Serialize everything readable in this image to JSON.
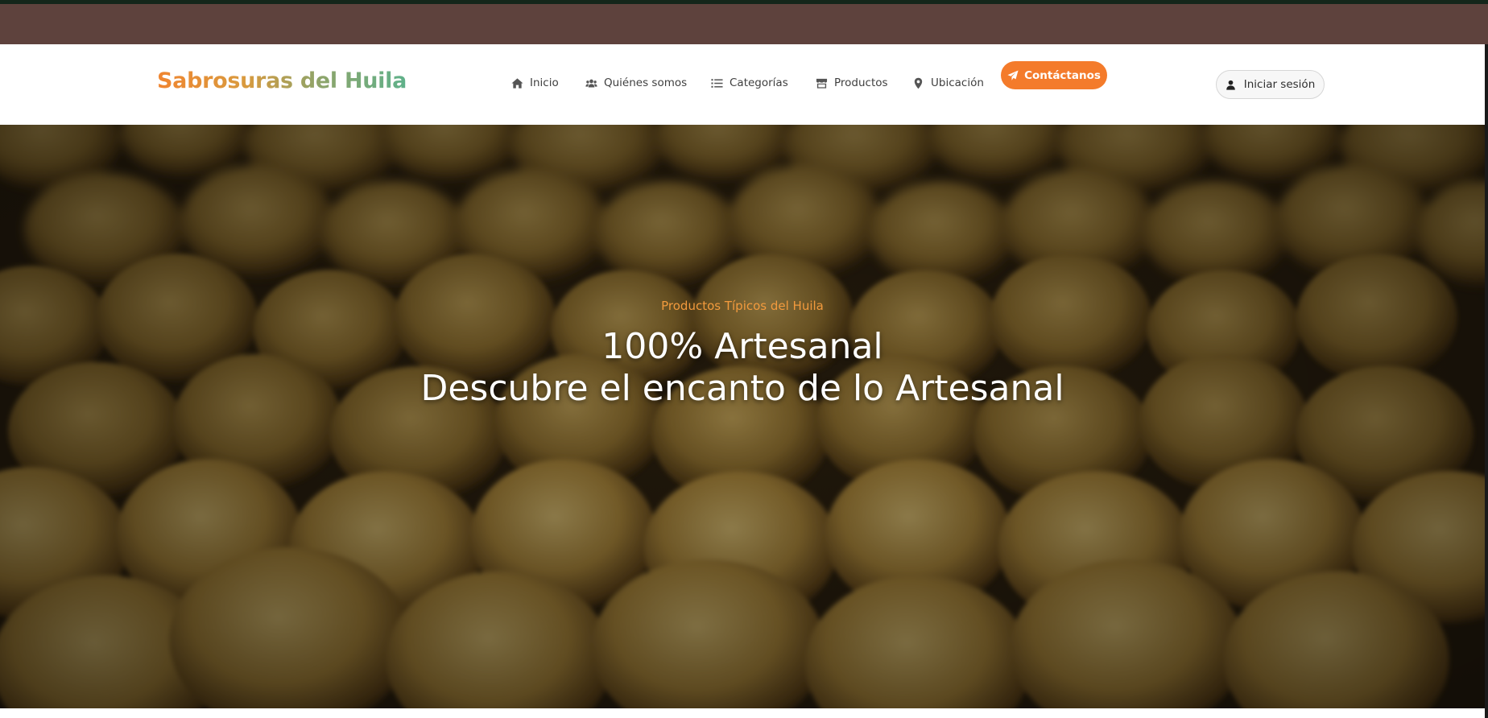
{
  "brand": {
    "name": "Sabrosuras del Huila"
  },
  "nav": {
    "items": [
      {
        "label": "Inicio",
        "icon": "home-icon"
      },
      {
        "label": "Quiénes somos",
        "icon": "users-icon"
      },
      {
        "label": "Categorías",
        "icon": "list-icon"
      },
      {
        "label": "Productos",
        "icon": "store-icon"
      },
      {
        "label": "Ubicación",
        "icon": "map-pin-icon"
      }
    ],
    "contact_label": "Contáctanos",
    "contact_icon": "paper-plane-icon",
    "login_label": "Iniciar sesión",
    "login_icon": "user-icon"
  },
  "hero": {
    "kicker": "Productos Típicos del Huila",
    "title_line1": "100% Artesanal",
    "title_line2": "Descubre el encanto de lo Artesanal"
  },
  "colors": {
    "topbar": "#5e423d",
    "accent": "#f47b2b",
    "kicker": "#f29a3d"
  }
}
